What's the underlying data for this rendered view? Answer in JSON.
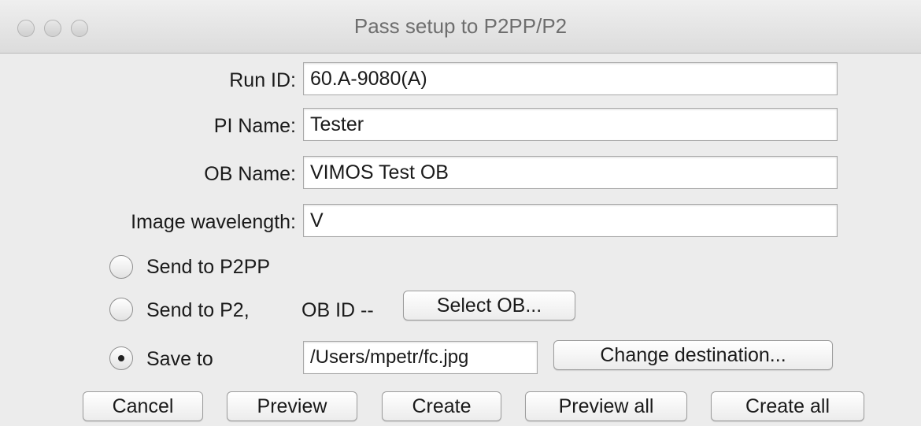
{
  "window": {
    "title": "Pass setup to P2PP/P2"
  },
  "form": {
    "run_id": {
      "label": "Run ID:",
      "value": "60.A-9080(A)"
    },
    "pi_name": {
      "label": "PI Name:",
      "value": "Tester"
    },
    "ob_name": {
      "label": "OB Name:",
      "value": "VIMOS Test OB"
    },
    "image_wavelength": {
      "label": "Image wavelength:",
      "value": "V"
    }
  },
  "options": {
    "send_p2pp": {
      "label": "Send to P2PP",
      "selected": false
    },
    "send_p2": {
      "label": "Send to P2,",
      "selected": false,
      "ob_id_text": "OB ID --",
      "select_ob_label": "Select OB..."
    },
    "save_to": {
      "label": "Save to",
      "selected": true,
      "path": "/Users/mpetr/fc.jpg",
      "change_label": "Change destination..."
    }
  },
  "buttons": {
    "cancel": "Cancel",
    "preview": "Preview",
    "create": "Create",
    "preview_all": "Preview all",
    "create_all": "Create all"
  }
}
